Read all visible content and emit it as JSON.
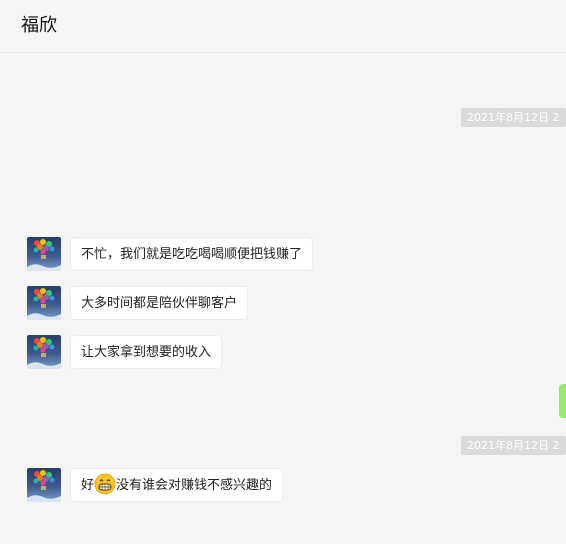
{
  "header": {
    "title": "福欣"
  },
  "timestamps": [
    "2021年8月12日 2",
    "2021年8月12日 2"
  ],
  "messages": [
    {
      "text": "不忙，我们就是吃吃喝喝顺便把钱赚了"
    },
    {
      "text": "大多时间都是陪伙伴聊客户"
    },
    {
      "text": "让大家拿到想要的收入"
    },
    {
      "text_before": "好",
      "emoji": "grinning-face-emoji",
      "text_after": "没有谁会对赚钱不感兴趣的"
    }
  ],
  "colors": {
    "background": "#f5f5f5",
    "self_bubble": "#95ec69",
    "other_bubble": "#ffffff",
    "timestamp_bg": "#dadada"
  }
}
